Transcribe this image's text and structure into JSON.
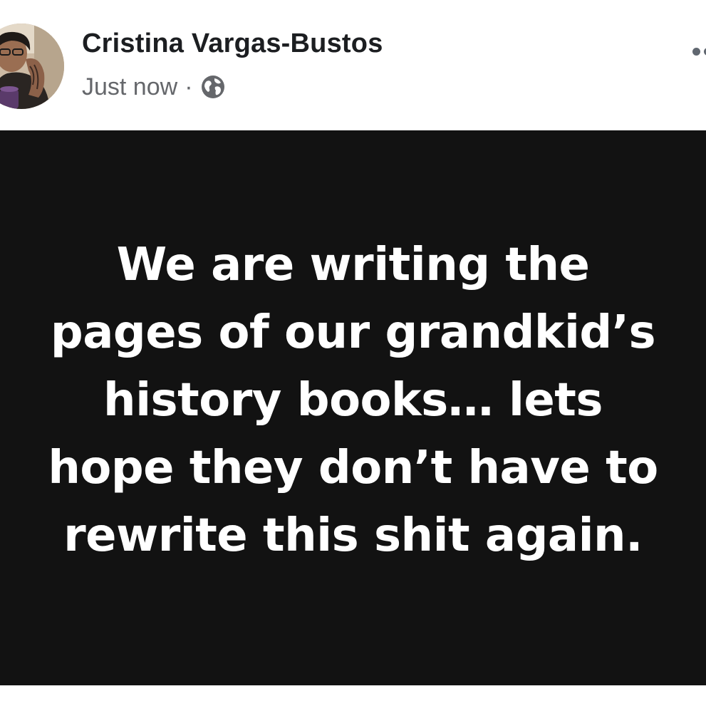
{
  "post": {
    "author": "Cristina Vargas-Bustos",
    "timestamp": "Just now",
    "separator": "·",
    "privacy_icon": "globe-icon",
    "more_icon": "more-options-icon",
    "text_lines": [
      "We are writing the",
      "pages of our grandkid’s",
      "history books… lets",
      "hope they don’t have to",
      "rewrite this shit again."
    ],
    "background_color": "#121212",
    "text_color": "#ffffff"
  }
}
